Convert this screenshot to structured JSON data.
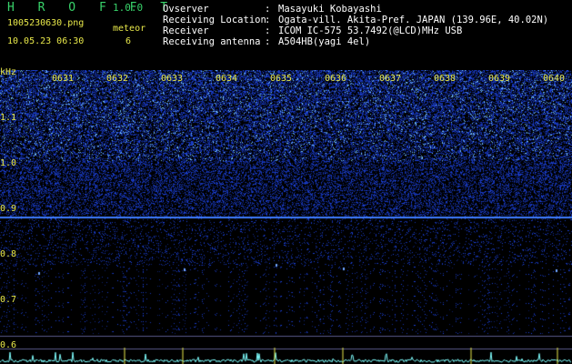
{
  "app": {
    "name_letters": "H R O F F T",
    "version": "1.0.0"
  },
  "file": {
    "filename": "1005230630.png",
    "datetime": "10.05.23 06:30"
  },
  "meteor": {
    "label": "meteor",
    "count": "6"
  },
  "info": [
    {
      "label": "Ovserver",
      "sep": ":",
      "value": "Masayuki Kobayashi"
    },
    {
      "label": "Receiving Location",
      "sep": ":",
      "value": "Ogata-vill. Akita-Pref. JAPAN (139.96E, 40.02N)"
    },
    {
      "label": "Receiver",
      "sep": ":",
      "value": "ICOM IC-575 53.7492(@LCD)MHz USB"
    },
    {
      "label": "Receiving antenna",
      "sep": ":",
      "value": "A504HB(yagi 4el)"
    }
  ],
  "yaxis": {
    "unit": "kHz",
    "ticks": [
      "1.1",
      "1.0",
      "0.9",
      "0.8",
      "0.7",
      "0.6"
    ]
  },
  "time_ticks": [
    "0631",
    "0632",
    "0633",
    "0634",
    "0635",
    "0636",
    "0637",
    "0638",
    "0639",
    "0640"
  ],
  "colors": {
    "title_green": "#38d26a",
    "label_yellow": "#e8e84a",
    "info_white": "#ffffff",
    "spectrum_blue": "#2a5cff",
    "trace_cyan": "#7fffff"
  }
}
